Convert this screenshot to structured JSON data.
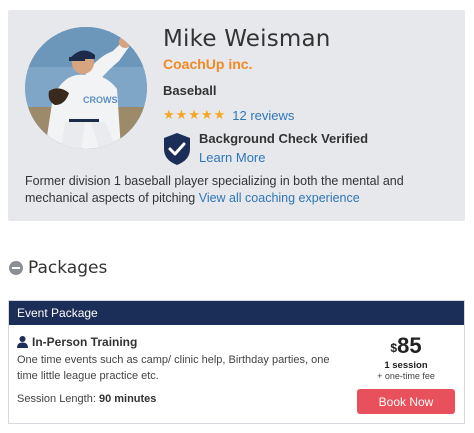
{
  "coach": {
    "name": "Mike Weisman",
    "company": "CoachUp inc.",
    "sport": "Baseball",
    "rating_stars": "★★★★★",
    "rating_value": 5,
    "reviews_label": "12 reviews",
    "background_check": "Background Check Verified",
    "learn_more": "Learn More",
    "bio_text": "Former division 1 baseball player specializing in both the mental and mechanical aspects of pitching ",
    "bio_link": "View all coaching experience"
  },
  "packages": {
    "heading": "Packages",
    "items": [
      {
        "type": "Event Package",
        "title": "In-Person Training",
        "description": "One time events such as camp/ clinic help, Birthday parties, one time little league practice etc.",
        "session_length_label": "Session Length:",
        "session_length_value": "90 minutes",
        "currency": "$",
        "price": "85",
        "sessions": "1 session",
        "fee": "+ one-time fee",
        "book_label": "Book Now"
      }
    ]
  },
  "colors": {
    "accent_orange": "#f08a24",
    "link_blue": "#2f77b8",
    "navy": "#1b2e57",
    "button_red": "#e8505b",
    "star_gold": "#f5a623"
  }
}
